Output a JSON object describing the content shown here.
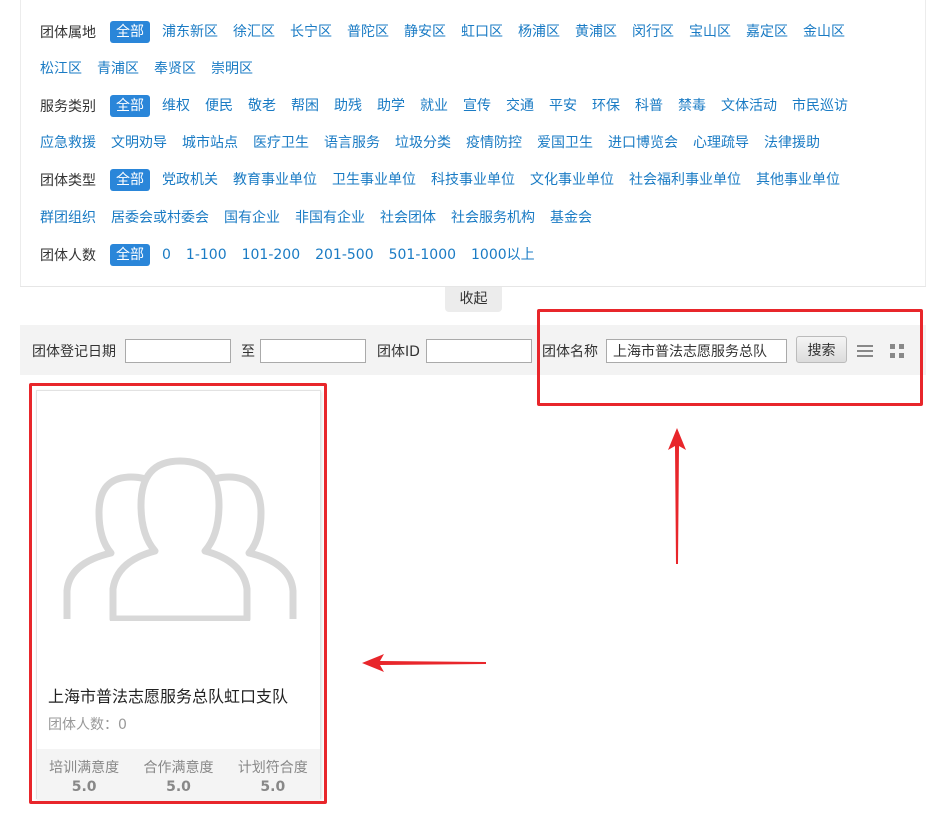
{
  "filters": {
    "region": {
      "label": "团体属地",
      "row1": [
        "全部",
        "浦东新区",
        "徐汇区",
        "长宁区",
        "普陀区",
        "静安区",
        "虹口区",
        "杨浦区",
        "黄浦区",
        "闵行区",
        "宝山区",
        "嘉定区",
        "金山区"
      ],
      "row2": [
        "松江区",
        "青浦区",
        "奉贤区",
        "崇明区"
      ]
    },
    "service": {
      "label": "服务类别",
      "row1": [
        "全部",
        "维权",
        "便民",
        "敬老",
        "帮困",
        "助残",
        "助学",
        "就业",
        "宣传",
        "交通",
        "平安",
        "环保",
        "科普",
        "禁毒",
        "文体活动",
        "市民巡访"
      ],
      "row2": [
        "应急救援",
        "文明劝导",
        "城市站点",
        "医疗卫生",
        "语言服务",
        "垃圾分类",
        "疫情防控",
        "爱国卫生",
        "进口博览会",
        "心理疏导",
        "法律援助"
      ]
    },
    "group_type": {
      "label": "团体类型",
      "row1": [
        "全部",
        "党政机关",
        "教育事业单位",
        "卫生事业单位",
        "科技事业单位",
        "文化事业单位",
        "社会福利事业单位",
        "其他事业单位"
      ],
      "row2": [
        "群团组织",
        "居委会或村委会",
        "国有企业",
        "非国有企业",
        "社会团体",
        "社会服务机构",
        "基金会"
      ]
    },
    "size": {
      "label": "团体人数",
      "row1": [
        "全部",
        "0",
        "1-100",
        "101-200",
        "201-500",
        "501-1000",
        "1000以上"
      ]
    },
    "collapse_label": "收起"
  },
  "search": {
    "date_label": "团体登记日期",
    "date_from": "",
    "to_label": "至",
    "date_to": "",
    "id_label": "团体ID",
    "id_value": "",
    "name_label": "团体名称",
    "name_value": "上海市普法志愿服务总队",
    "search_button": "搜索",
    "list_view_icon": "list-icon",
    "grid_view_icon": "grid-icon"
  },
  "results": [
    {
      "title": "上海市普法志愿服务总队虹口支队",
      "count_label": "团体人数：0",
      "metrics": [
        {
          "label": "培训满意度",
          "value": "5.0"
        },
        {
          "label": "合作满意度",
          "value": "5.0"
        },
        {
          "label": "计划符合度",
          "value": "5.0"
        }
      ]
    }
  ],
  "colors": {
    "accent": "#2a86d9",
    "link": "#1a7bc4",
    "highlight": "#e8262b"
  }
}
